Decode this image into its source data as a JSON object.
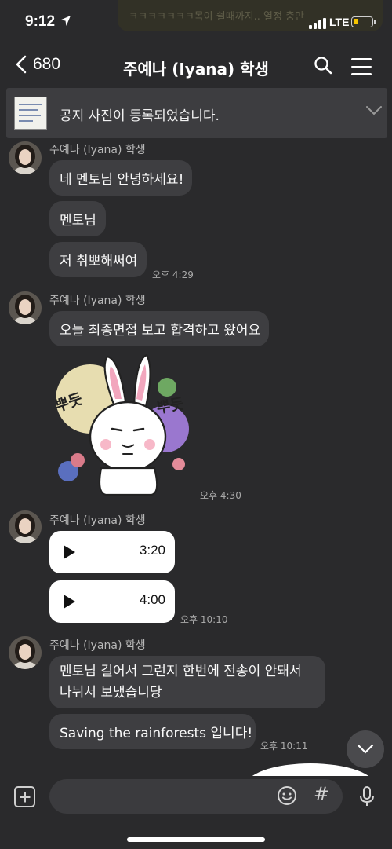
{
  "status_bar": {
    "time": "9:12",
    "carrier": "LTE",
    "notification_preview": "ㅋㅋㅋㅋㅋㅋㅋ목이 쉴때까지.. 열정 충만"
  },
  "header": {
    "back_count": "680",
    "title": "주예나 (Iyana) 학생"
  },
  "notice": {
    "text": "공지 사진이 등록되었습니다."
  },
  "groups": [
    {
      "sender": "주예나 (Iyana) 학생",
      "messages": [
        "네 멘토님 안녕하세요!",
        "멘토님",
        "저 취뽀해써여"
      ],
      "time": "오후 4:29"
    },
    {
      "sender": "주예나 (Iyana) 학생",
      "messages": [
        "오늘 최종면접 보고 합격하고 왔어요"
      ],
      "sticker_text": [
        "뿌듯",
        "뿌듯"
      ],
      "time": "오후 4:30"
    },
    {
      "sender": "주예나 (Iyana) 학생",
      "voice_messages": [
        "3:20",
        "4:00"
      ],
      "time": "오후 10:10"
    },
    {
      "sender": "주예나 (Iyana) 학생",
      "messages": [
        "멘토님 길어서 그런지 한번에 전송이 안돼서 나뉘서 보냈습니당",
        "Saving the rainforests 입니다!"
      ],
      "time": "오후 10:11"
    }
  ],
  "input": {
    "placeholder": "",
    "hash_label": "#"
  },
  "colors": {
    "background": "#2a2a2c",
    "bubble": "#3e3e41",
    "voice_bubble": "#ffffff",
    "battery": "#f5c400"
  },
  "icons": {
    "back": "chevron-left-icon",
    "search": "search-icon",
    "menu": "hamburger-menu-icon",
    "notice_expand": "chevron-down-icon",
    "attach": "plus-square-icon",
    "emoji": "emoji-icon",
    "hash": "hash-icon",
    "mic": "microphone-icon",
    "play": "play-icon",
    "scroll_down": "chevron-down-icon"
  }
}
